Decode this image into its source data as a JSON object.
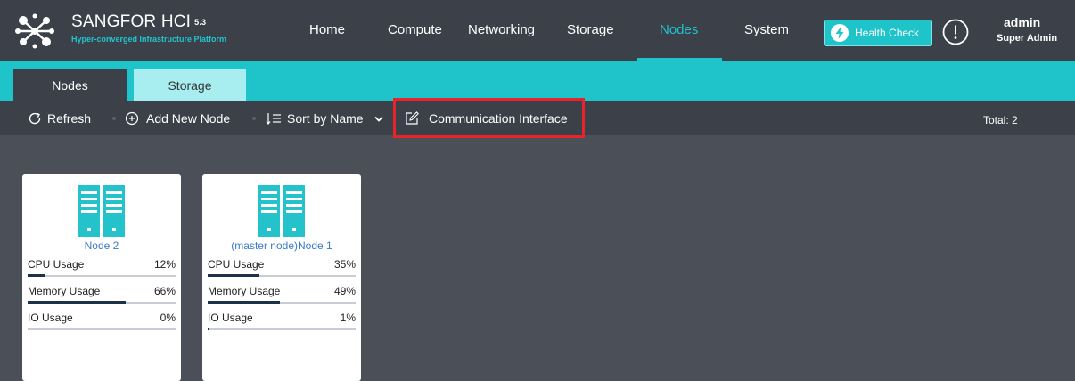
{
  "header": {
    "brand_title": "SANGFOR HCI",
    "brand_version": "5.3",
    "brand_subtitle": "Hyper-converged Infrastructure Platform",
    "nav": [
      {
        "label": "Home",
        "active": false
      },
      {
        "label": "Compute",
        "active": false
      },
      {
        "label": "Networking",
        "active": false
      },
      {
        "label": "Storage",
        "active": false
      },
      {
        "label": "Nodes",
        "active": true
      },
      {
        "label": "System",
        "active": false
      }
    ],
    "health_check_label": "Health Check",
    "alert_icon": "exclamation-circle-icon",
    "user_name": "admin",
    "user_role": "Super Admin"
  },
  "tabs": [
    {
      "label": "Nodes",
      "active": true
    },
    {
      "label": "Storage",
      "active": false
    }
  ],
  "toolbar": {
    "refresh_label": "Refresh",
    "add_node_label": "Add New Node",
    "sort_label": "Sort by Name",
    "comm_interface_label": "Communication Interface",
    "total_text": "Total: 2"
  },
  "nodes": [
    {
      "name": "Node 2",
      "metrics": [
        {
          "label": "CPU Usage",
          "value": "12%",
          "percent": 12
        },
        {
          "label": "Memory Usage",
          "value": "66%",
          "percent": 66
        },
        {
          "label": "IO Usage",
          "value": "0%",
          "percent": 0
        }
      ]
    },
    {
      "name": "(master node)Node 1",
      "metrics": [
        {
          "label": "CPU Usage",
          "value": "35%",
          "percent": 35
        },
        {
          "label": "Memory Usage",
          "value": "49%",
          "percent": 49
        },
        {
          "label": "IO Usage",
          "value": "1%",
          "percent": 1
        }
      ]
    }
  ],
  "colors": {
    "accent": "#1fc3ca",
    "header_bg": "#3b4049",
    "page_bg": "#4a4f58",
    "highlight": "#e8232b",
    "node_name": "#3a7bc8",
    "bar_fill": "#1d3149"
  }
}
